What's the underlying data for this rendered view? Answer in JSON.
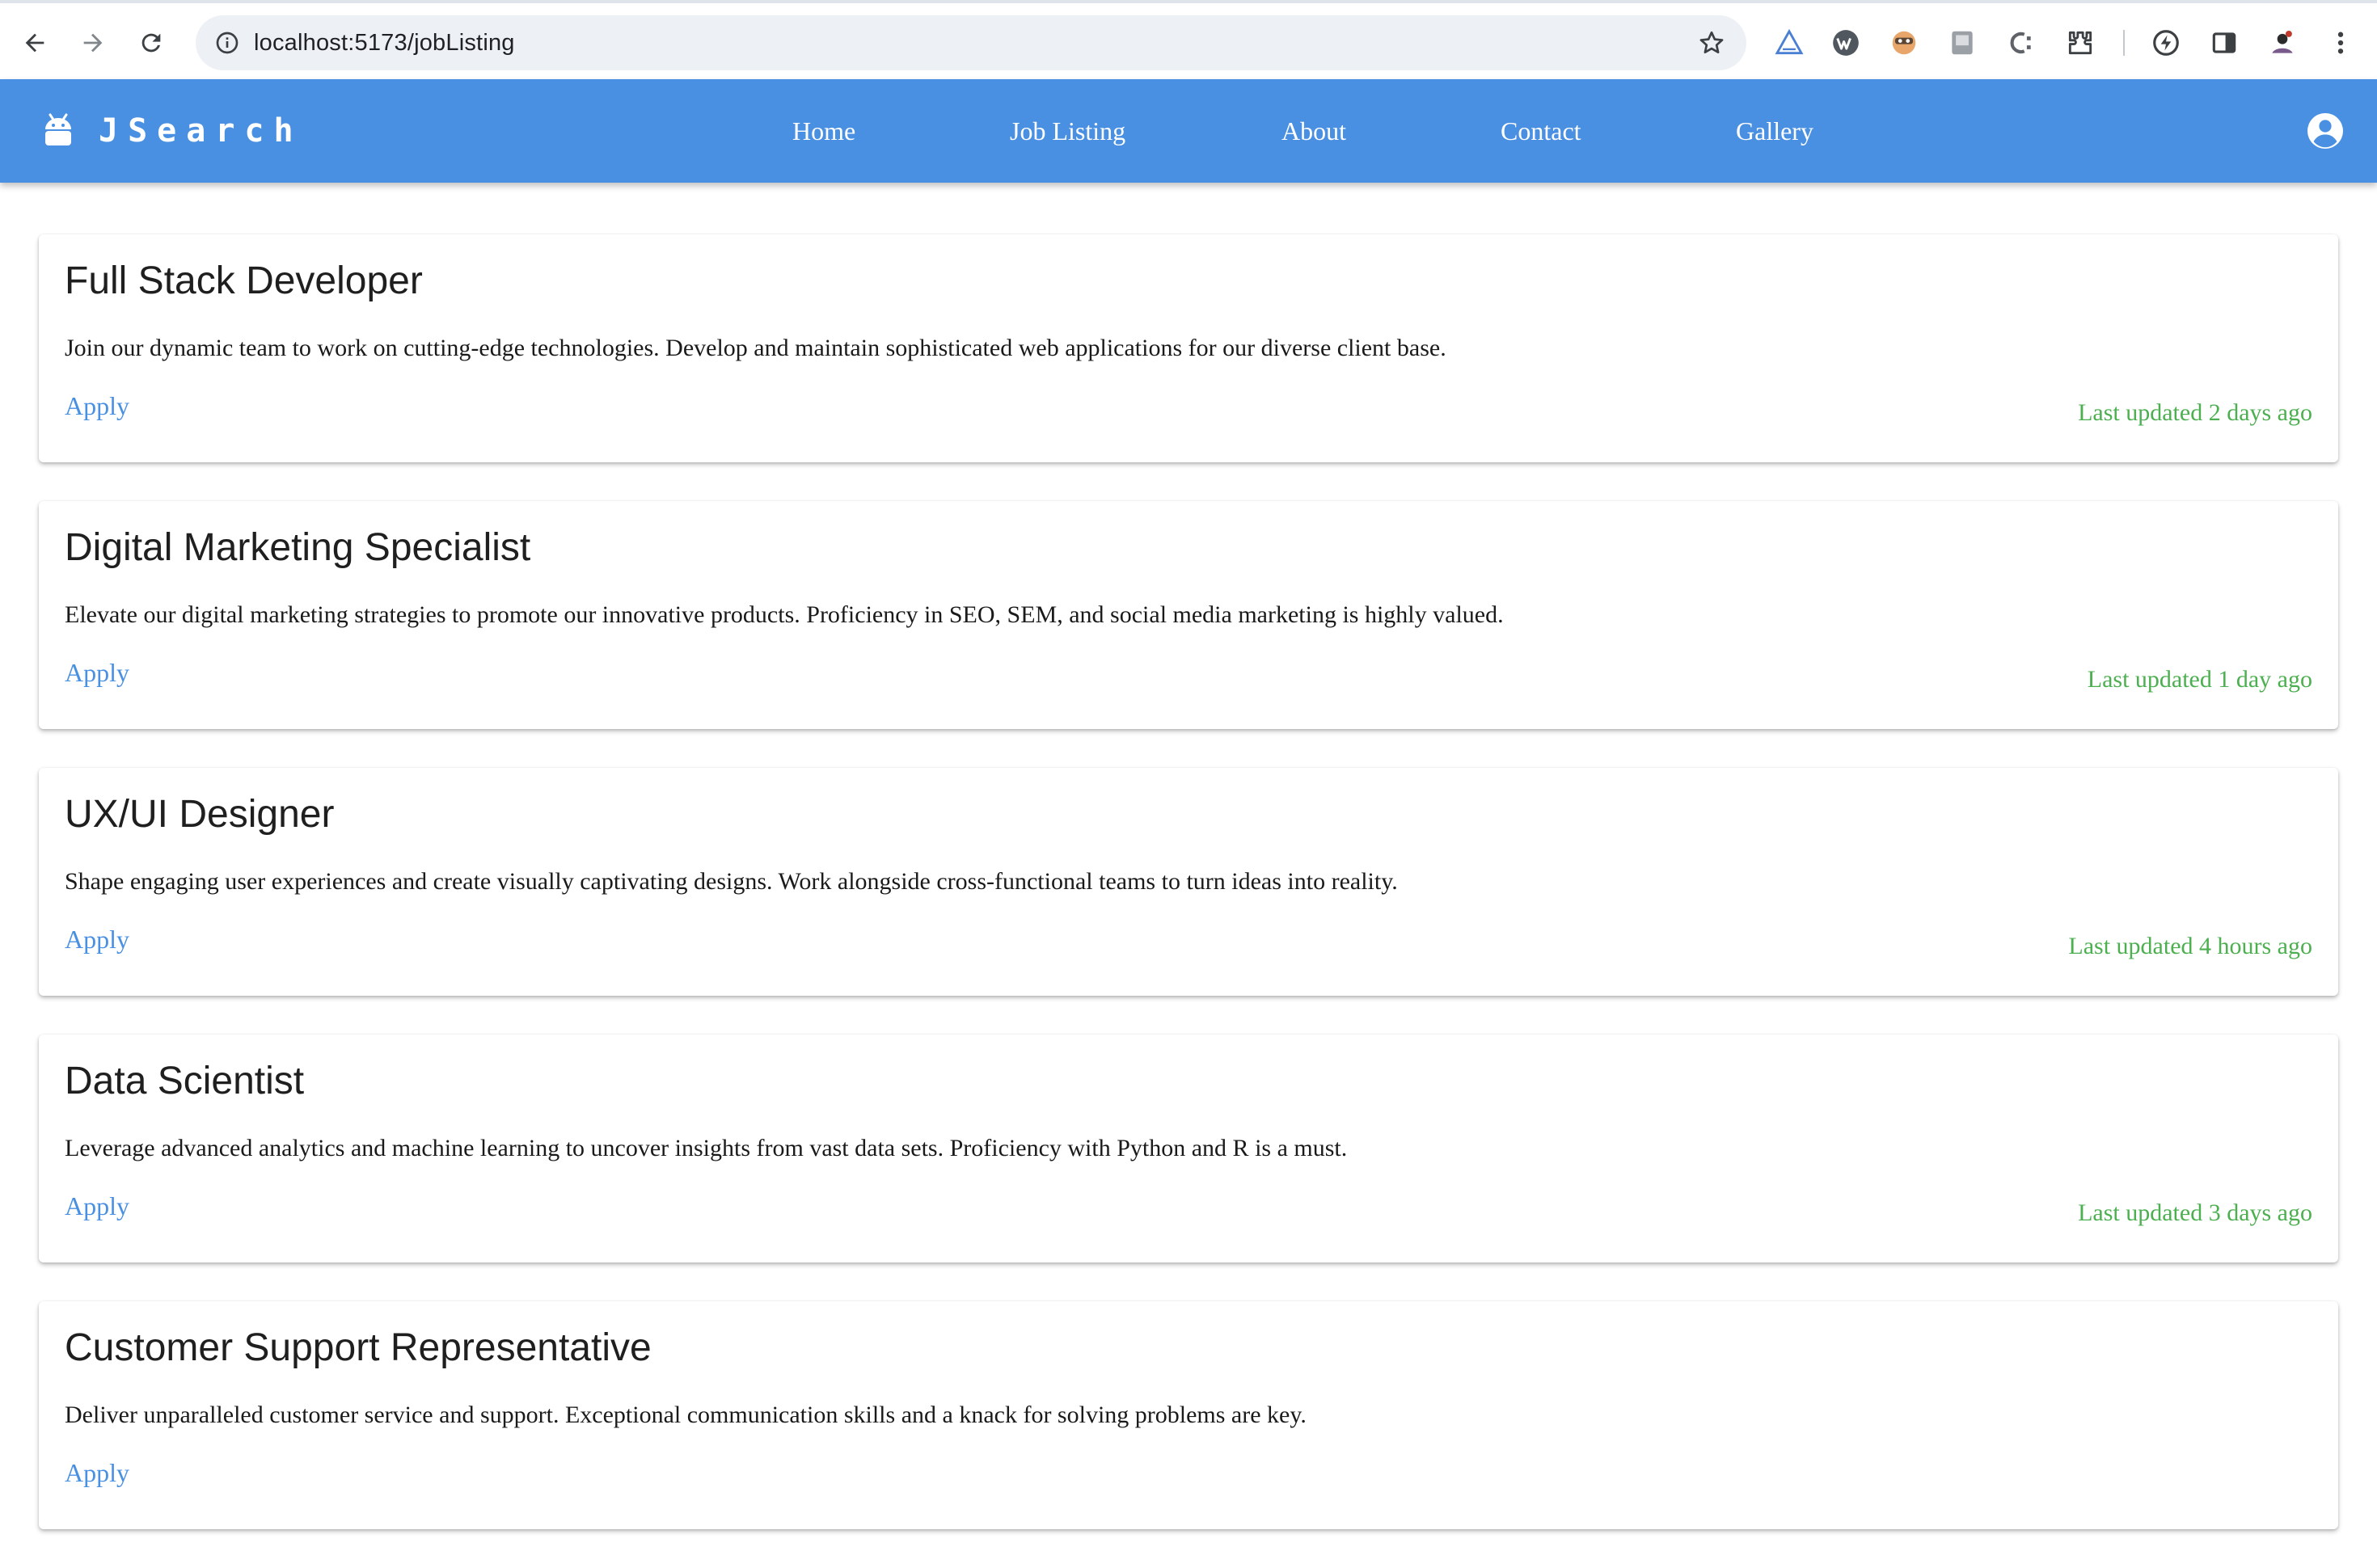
{
  "browser": {
    "url": "localhost:5173/jobListing",
    "extensions": [
      "triangle-extension-icon",
      "wordpress-extension-icon",
      "face-extension-icon",
      "reader-extension-icon",
      "css-extension-icon",
      "puzzle-extensions-icon",
      "lightning-extension-icon",
      "side-panel-icon",
      "profile-avatar-icon",
      "kebab-menu-icon"
    ]
  },
  "navbar": {
    "brand": "JSearch",
    "links": [
      {
        "label": "Home"
      },
      {
        "label": "Job Listing"
      },
      {
        "label": "About"
      },
      {
        "label": "Contact"
      },
      {
        "label": "Gallery"
      }
    ],
    "color": "#4a90e2"
  },
  "jobs": [
    {
      "title": "Full Stack Developer",
      "description": "Join our dynamic team to work on cutting-edge technologies. Develop and maintain sophisticated web applications for our diverse client base.",
      "apply_label": "Apply",
      "updated": "Last updated 2 days ago"
    },
    {
      "title": "Digital Marketing Specialist",
      "description": "Elevate our digital marketing strategies to promote our innovative products. Proficiency in SEO, SEM, and social media marketing is highly valued.",
      "apply_label": "Apply",
      "updated": "Last updated 1 day ago"
    },
    {
      "title": "UX/UI Designer",
      "description": "Shape engaging user experiences and create visually captivating designs. Work alongside cross-functional teams to turn ideas into reality.",
      "apply_label": "Apply",
      "updated": "Last updated 4 hours ago"
    },
    {
      "title": "Data Scientist",
      "description": "Leverage advanced analytics and machine learning to uncover insights from vast data sets. Proficiency with Python and R is a must.",
      "apply_label": "Apply",
      "updated": "Last updated 3 days ago"
    },
    {
      "title": "Customer Support Representative",
      "description": "Deliver unparalleled customer service and support. Exceptional communication skills and a knack for solving problems are key.",
      "apply_label": "Apply",
      "updated": ""
    }
  ],
  "colors": {
    "accent": "#4a90e2",
    "updated_text": "#4caf50"
  }
}
